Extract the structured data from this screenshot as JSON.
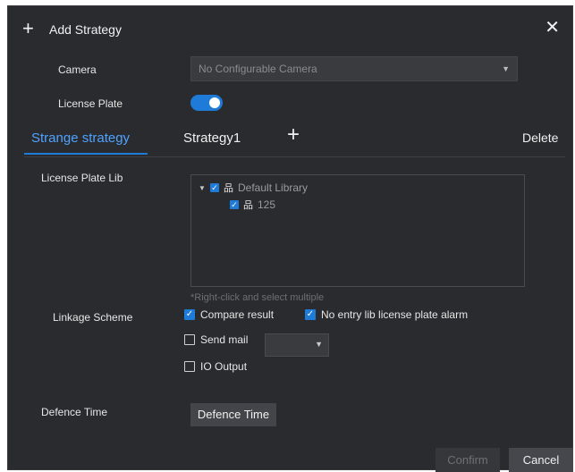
{
  "dialog": {
    "title": "Add Strategy",
    "plus_icon": "plus-icon",
    "close_icon": "close-icon"
  },
  "form": {
    "camera_label": "Camera",
    "camera_value": "No Configurable Camera",
    "license_plate_label": "License Plate",
    "license_plate_enabled": true,
    "license_plate_lib_label": "License Plate Lib",
    "linkage_scheme_label": "Linkage Scheme",
    "defence_time_label": "Defence Time"
  },
  "tabs": {
    "items": [
      {
        "label": "Strange strategy",
        "active": true
      },
      {
        "label": "Strategy1",
        "active": false
      }
    ],
    "add_icon": "plus-icon",
    "delete_label": "Delete"
  },
  "library_tree": {
    "root": {
      "label": "Default Library",
      "checked": true,
      "expanded": true
    },
    "children": [
      {
        "label": "125",
        "checked": true
      }
    ],
    "hint": "*Right-click and select multiple"
  },
  "linkage": {
    "compare_result": {
      "label": "Compare result",
      "checked": true
    },
    "no_entry_alarm": {
      "label": "No entry lib license plate alarm",
      "checked": true
    },
    "send_mail": {
      "label": "Send mail",
      "checked": false,
      "selected_value": ""
    },
    "io_output": {
      "label": "IO Output",
      "checked": false
    }
  },
  "buttons": {
    "defence_time": "Defence Time",
    "confirm": "Confirm",
    "cancel": "Cancel"
  },
  "colors": {
    "accent": "#1e7bd8",
    "active_tab": "#4fa3ff",
    "background": "#2a2b2e"
  }
}
